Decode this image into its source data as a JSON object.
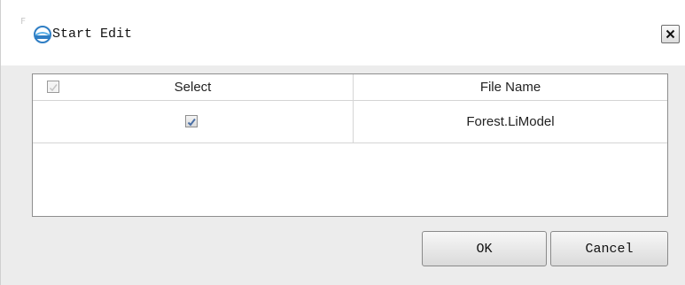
{
  "window": {
    "corner_mark": "F",
    "title": "Start Edit",
    "logo_icon": "app-logo-icon",
    "close_icon": "close-icon"
  },
  "table": {
    "columns": [
      "Select",
      "File Name"
    ],
    "header_checkbox_checked": true,
    "rows": [
      {
        "checked": true,
        "file_name": "Forest.LiModel"
      }
    ]
  },
  "buttons": {
    "ok": "OK",
    "cancel": "Cancel"
  },
  "colors": {
    "dialog_bg": "#ececec",
    "check_mark": "#4a6fa5"
  }
}
